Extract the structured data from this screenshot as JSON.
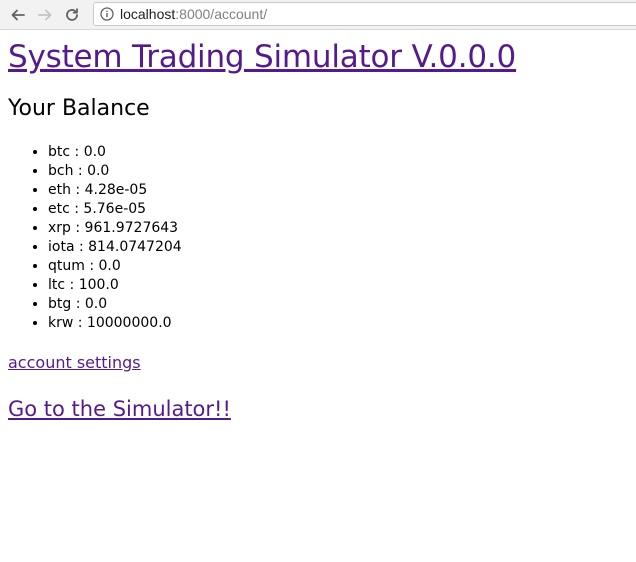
{
  "browser": {
    "url_host": "localhost",
    "url_rest": ":8000/account/"
  },
  "page": {
    "title": "System Trading Simulator V.0.0.0",
    "balance_heading": "Your Balance",
    "balances": [
      {
        "text": "btc : 0.0"
      },
      {
        "text": "bch : 0.0"
      },
      {
        "text": "eth : 4.28e-05"
      },
      {
        "text": "etc : 5.76e-05"
      },
      {
        "text": "xrp : 961.9727643"
      },
      {
        "text": "iota : 814.0747204"
      },
      {
        "text": "qtum : 0.0"
      },
      {
        "text": "ltc : 100.0"
      },
      {
        "text": "btg : 0.0"
      },
      {
        "text": "krw : 10000000.0"
      }
    ],
    "settings_link": "account settings",
    "simulator_link": "Go to the Simulator!!"
  },
  "colors": {
    "link_visited": "#551a8b"
  }
}
